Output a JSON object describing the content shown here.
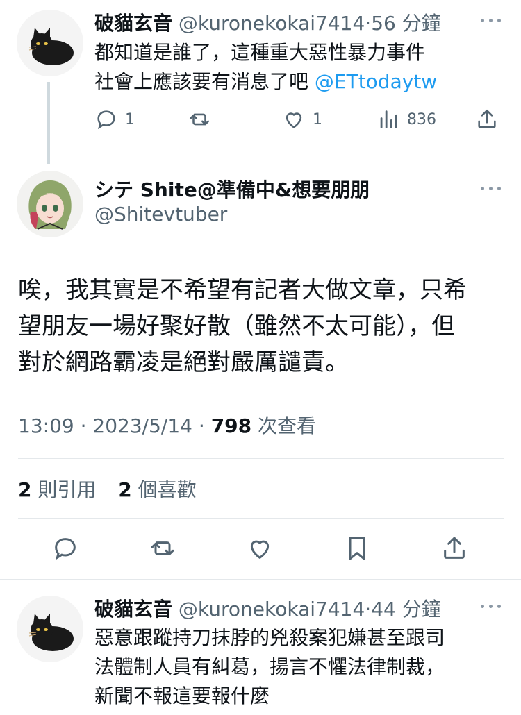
{
  "tweet1": {
    "name": "破貓玄音",
    "handle": "@kuronekokai7414",
    "separator": "·",
    "time": "56 分鐘",
    "line1": "都知道是誰了，這種重大惡性暴力事件",
    "line2": "社會上應該要有消息了吧 ",
    "mention": "@ETtodaytw",
    "replies": "1",
    "retweets": "",
    "likes": "1",
    "views": "836"
  },
  "main": {
    "name": "シテ Shite@準備中&想要朋朋",
    "handle": "@Shitevtuber",
    "text_line1": "唉，我其實是不希望有記者大做文章，只希",
    "text_line2": "望朋友一場好聚好散（雖然不太可能），但",
    "text_line3": "對於網路霸凌是絕對嚴厲譴責。",
    "time": "13:09",
    "sep": " · ",
    "date": "2023/5/14",
    "views_count": "798",
    "views_label": " 次查看",
    "quotes_count": "2",
    "quotes_label": " 則引用",
    "likes_count": "2",
    "likes_label": " 個喜歡"
  },
  "tweet2": {
    "name": "破貓玄音",
    "handle": "@kuronekokai7414",
    "separator": "·",
    "time": "44 分鐘",
    "line1": "惡意跟蹤持刀抹脖的兇殺案犯嫌甚至跟司",
    "line2": "法體制人員有糾葛，揚言不懼法律制裁，",
    "line3": "新聞不報這要報什麼"
  },
  "colors": {
    "link": "#1d9bf0",
    "secondary_text": "#536471",
    "primary_text": "#0f1419"
  }
}
